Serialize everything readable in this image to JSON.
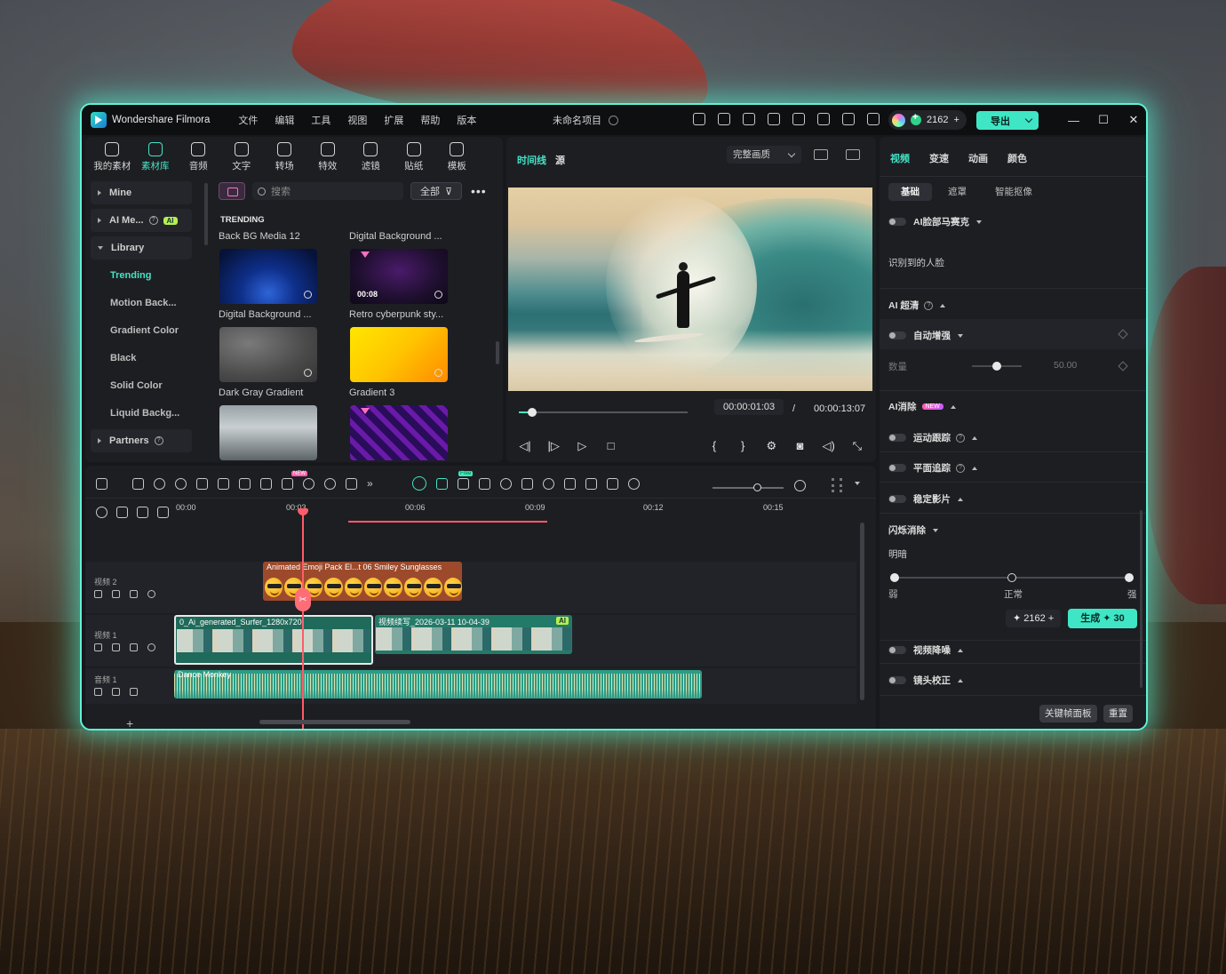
{
  "app": {
    "name": "Wondershare Filmora",
    "menu": [
      "文件",
      "编辑",
      "工具",
      "视图",
      "扩展",
      "帮助",
      "版本"
    ],
    "project_title": "未命名项目",
    "credits": "2162",
    "export_label": "导出",
    "window_controls": [
      "—",
      "☐",
      "✕"
    ]
  },
  "library": {
    "tabs": [
      {
        "label": "我的素材",
        "icon": "media-icon"
      },
      {
        "label": "素材库",
        "icon": "stock-library-icon"
      },
      {
        "label": "音频",
        "icon": "music-icon"
      },
      {
        "label": "文字",
        "icon": "text-icon"
      },
      {
        "label": "转场",
        "icon": "transition-icon"
      },
      {
        "label": "特效",
        "icon": "effects-icon"
      },
      {
        "label": "滤镜",
        "icon": "filter-icon"
      },
      {
        "label": "贴纸",
        "icon": "sticker-icon"
      },
      {
        "label": "模板",
        "icon": "template-icon"
      }
    ],
    "active_tab": "素材库",
    "sidebar": {
      "mine": "Mine",
      "ai_media": "AI Me...",
      "ai_badge": "AI",
      "library": "Library",
      "sub_items": [
        "Trending",
        "Motion Back...",
        "Gradient Color",
        "Black",
        "Solid Color",
        "Liquid Backg..."
      ],
      "active_item": "Trending",
      "partners": "Partners"
    },
    "search_placeholder": "搜索",
    "filter_label": "全部",
    "section_title": "TRENDING",
    "top_labels": [
      "Back BG Media 12",
      "Digital Background ..."
    ],
    "cards": [
      {
        "label": "Digital Background ...",
        "duration": "",
        "thumb_color": "#0b2a6a"
      },
      {
        "label": "Retro cyberpunk sty...",
        "duration": "00:08",
        "thumb_color": "#1a0f2a"
      },
      {
        "label": "Dark Gray Gradient",
        "duration": "",
        "thumb_color": "#555"
      },
      {
        "label": "Gradient 3",
        "duration": "",
        "thumb_color": "#ffd400"
      }
    ]
  },
  "preview": {
    "tabs": [
      "时间线",
      "源"
    ],
    "active_tab": "时间线",
    "quality": "完整画质",
    "current_time": "00:00:01:03",
    "separator": "/",
    "total_time": "00:00:13:07",
    "progress": 0.08,
    "controls": [
      "prev-frame",
      "play-slow",
      "play",
      "stop",
      "mark-in",
      "mark-out",
      "settings",
      "snapshot",
      "volume",
      "fullscreen"
    ]
  },
  "properties": {
    "tabs": [
      "视频",
      "变速",
      "动画",
      "颜色"
    ],
    "active_tab": "视频",
    "sub_tabs": [
      "基础",
      "遮罩",
      "智能抠像"
    ],
    "active_sub_tab": "基础",
    "ai_face_mosaic": "AI脸部马赛克",
    "detected_faces": "识别到的人脸",
    "ai_hd": "AI 超清",
    "auto_enhance": "自动增强",
    "amount_label": "数量",
    "amount_value": "50.00",
    "amount_level": 0.5,
    "ai_remove": "AI消除",
    "new_badge": "NEW",
    "motion_tracking": "运动跟踪",
    "planar_tracking": "平面追踪",
    "stabilization": "稳定影片",
    "flicker_removal": "闪烁消除",
    "brightness_label": "明暗",
    "scale_labels": [
      "弱",
      "正常",
      "强"
    ],
    "scale_level": 0.5,
    "credits": "2162",
    "generate_label": "生成",
    "generate_cost": "30",
    "denoise": "视频降噪",
    "lens_correction": "镜头校正",
    "keyframe_panel": "关键帧面板",
    "reset": "重置"
  },
  "timeline": {
    "ruler": [
      "00:00",
      "00:03",
      "00:06",
      "00:09",
      "00:12",
      "00:15"
    ],
    "tracks": [
      {
        "name": "视频 2"
      },
      {
        "name": "视频 1"
      },
      {
        "name": "音频 1"
      }
    ],
    "clips": {
      "emoji": "Animated Emoji Pack El...t 06 Smiley Sunglasses",
      "video_a": "0_Ai_generated_Surfer_1280x720",
      "video_b": "视频续写_2026-03-11 10-04-39",
      "ai_tag": "AI",
      "audio": "Dance Monkey"
    },
    "badges": {
      "new": "NEW",
      "free": "Free"
    },
    "add_track": "+"
  },
  "colors": {
    "accent": "#45e3c6",
    "window_glow": "#5ff2d6",
    "playhead": "#ff5c6a"
  }
}
